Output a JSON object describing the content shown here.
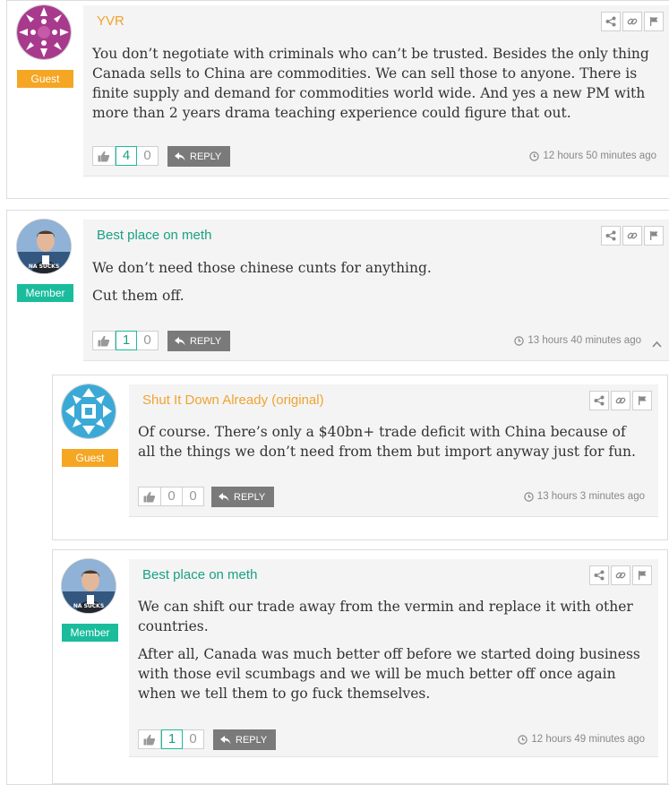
{
  "comments": [
    {
      "author": "YVR",
      "role": "Guest",
      "paragraphs": [
        "You don’t negotiate with criminals who can’t be trusted. Besides the only thing Canada sells to China are commodities. We can sell those to anyone. There is finite supply and demand for commodities world wide. And yes a new PM with more than 2 years drama teaching experience could figure that out."
      ],
      "upvotes": "4",
      "downvotes": "0",
      "reply_label": "REPLY",
      "timestamp": "12 hours 50 minutes ago"
    },
    {
      "author": "Best place on meth",
      "role": "Member",
      "paragraphs": [
        "We don’t need those chinese cunts for anything.",
        "Cut them off."
      ],
      "upvotes": "1",
      "downvotes": "0",
      "reply_label": "REPLY",
      "timestamp": "13 hours 40 minutes ago",
      "avatar_caption": "NA SUCKS"
    },
    {
      "author": "Shut It Down Already (original)",
      "role": "Guest",
      "paragraphs": [
        "Of course. There’s only a $40bn+ trade deficit with China because of all the things we don’t need from them but import anyway just for fun."
      ],
      "upvotes": "0",
      "downvotes": "0",
      "reply_label": "REPLY",
      "timestamp": "13 hours 3 minutes ago"
    },
    {
      "author": "Best place on meth",
      "role": "Member",
      "paragraphs": [
        "We can shift our trade away from the vermin and replace it with other countries.",
        "After all, Canada was much better off before we started doing business with those evil scumbags and we will be much better off once again when we tell them to go fuck themselves."
      ],
      "upvotes": "1",
      "downvotes": "0",
      "reply_label": "REPLY",
      "timestamp": "12 hours 49 minutes ago",
      "avatar_caption": "NA SUCKS"
    }
  ],
  "colors": {
    "guest_badge": "#f5a623",
    "member_badge": "#1abc9c",
    "guest_name": "#f0a330",
    "member_name": "#1aa084",
    "reply_button": "#7a7a7a",
    "comment_bg": "#f4f4f4"
  },
  "icons": [
    "share-icon",
    "link-icon",
    "flag-icon",
    "thumbs-up-icon",
    "reply-arrow-icon",
    "clock-icon",
    "collapse-chevron-icon"
  ]
}
